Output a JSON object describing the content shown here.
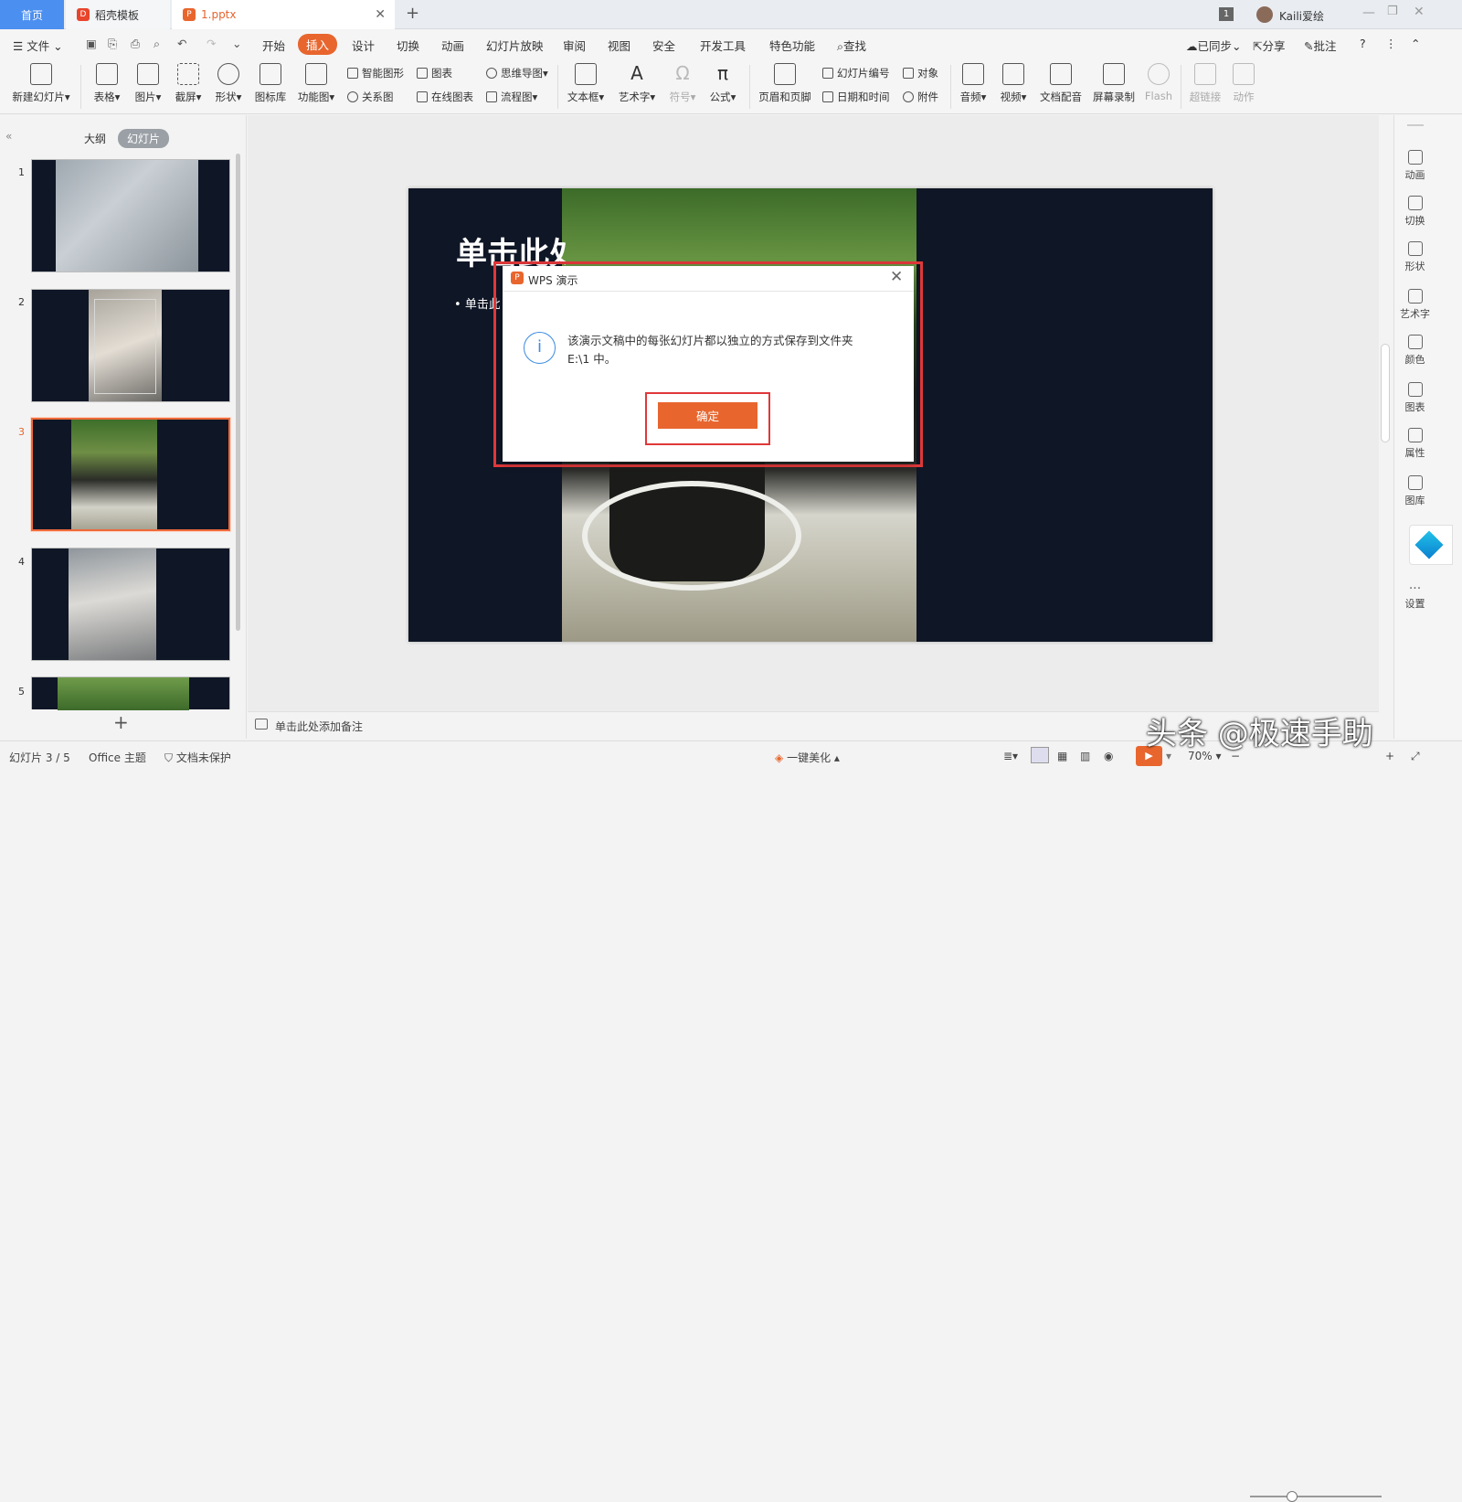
{
  "tabs": {
    "home": "首页",
    "template": "稻壳模板",
    "file": "1.pptx",
    "badge": "1",
    "user": "Kaili爱绘"
  },
  "menu": {
    "file": "文件",
    "items": [
      "开始",
      "插入",
      "设计",
      "切换",
      "动画",
      "幻灯片放映",
      "审阅",
      "视图",
      "安全",
      "开发工具",
      "特色功能"
    ],
    "active": "插入",
    "search": "查找",
    "synced": "已同步",
    "share": "分享",
    "comment": "批注"
  },
  "ribbon": {
    "new_slide": "新建幻灯片",
    "table": "表格",
    "picture": "图片",
    "screenshot": "截屏",
    "shape": "形状",
    "icon_lib": "图标库",
    "func_chart": "功能图",
    "smart_shape": "智能图形",
    "chart": "图表",
    "mindmap": "思维导图",
    "relation": "关系图",
    "online_chart": "在线图表",
    "flowchart": "流程图",
    "textbox": "文本框",
    "wordart": "艺术字",
    "symbol": "符号",
    "formula": "公式",
    "header_footer": "页眉和页脚",
    "slide_number": "幻灯片编号",
    "object": "对象",
    "datetime": "日期和时间",
    "attachment": "附件",
    "audio": "音频",
    "video": "视频",
    "narration": "文档配音",
    "screen_rec": "屏幕录制",
    "flash": "Flash",
    "hyperlink": "超链接",
    "action": "动作"
  },
  "leftpanel": {
    "outline": "大纲",
    "slides": "幻灯片",
    "thumbs": [
      "1",
      "2",
      "3",
      "4",
      "5"
    ],
    "selected": "3"
  },
  "slide": {
    "title": "单击此处",
    "bullet": "单击此"
  },
  "notes": {
    "placeholder": "单击此处添加备注"
  },
  "rightbar": [
    "动画",
    "切换",
    "形状",
    "艺术字",
    "颜色",
    "图表",
    "属性",
    "图库",
    "设置"
  ],
  "status": {
    "slide_count": "幻灯片 3 / 5",
    "theme": "Office 主题",
    "protect": "文档未保护",
    "beautify": "一键美化",
    "zoom": "70%"
  },
  "dialog": {
    "title": "WPS 演示",
    "message_line1": "该演示文稿中的每张幻灯片都以独立的方式保存到文件夹",
    "message_line2": "E:\\1 中。",
    "ok": "确定"
  },
  "watermark": "头条 @极速手助",
  "colors": {
    "accent": "#e8662e",
    "highlight": "#e0383a",
    "home_tab": "#4b8ff0",
    "slide_bg": "#0f1626"
  }
}
